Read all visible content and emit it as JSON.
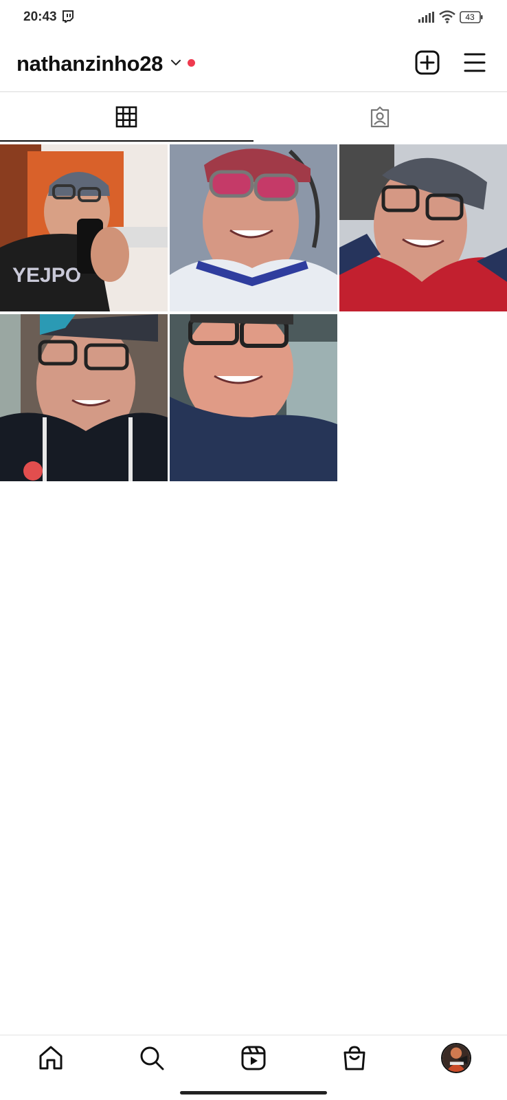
{
  "status_bar": {
    "time": "20:43",
    "notification_icon": "twitch-icon",
    "battery_level": "43",
    "icons": [
      "signal-icon",
      "wifi-icon",
      "battery-icon"
    ]
  },
  "header": {
    "username": "nathanzinho28",
    "dropdown_icon": "chevron-down-icon",
    "new_activity_dot_color": "#ef3a4f",
    "create_icon": "add-post-icon",
    "menu_icon": "hamburger-menu-icon"
  },
  "tabs": [
    {
      "name": "posts-grid",
      "icon": "grid-icon",
      "selected": true
    },
    {
      "name": "tagged",
      "icon": "tagged-user-icon",
      "selected": false
    }
  ],
  "posts": [
    {
      "id": "post-1",
      "description": "mirror selfie, cap, black shirt"
    },
    {
      "id": "post-2",
      "description": "selfie, red sunglasses, white jersey"
    },
    {
      "id": "post-3",
      "description": "selfie, glasses, red jacket"
    },
    {
      "id": "post-4",
      "description": "selfie, glasses, striped jersey"
    },
    {
      "id": "post-5",
      "description": "selfie, glasses, navy shirt"
    }
  ],
  "bottom_nav": [
    {
      "name": "home",
      "icon": "home-icon"
    },
    {
      "name": "search",
      "icon": "search-icon"
    },
    {
      "name": "reels",
      "icon": "reels-icon"
    },
    {
      "name": "shop",
      "icon": "shop-bag-icon"
    },
    {
      "name": "profile",
      "icon": "profile-avatar"
    }
  ],
  "colors": {
    "text": "#111111",
    "divider": "#dbdbdb",
    "accent_dot": "#ef3a4f"
  }
}
